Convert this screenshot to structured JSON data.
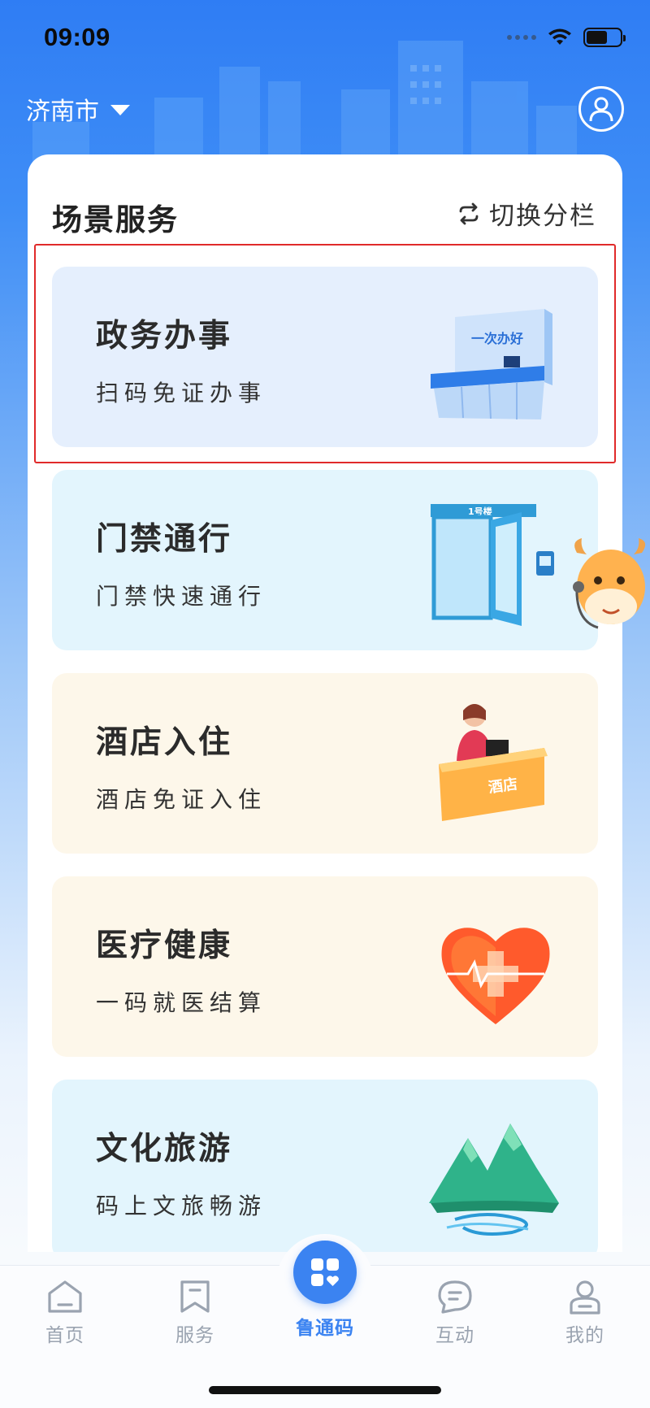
{
  "status_bar": {
    "time": "09:09"
  },
  "header": {
    "city": "济南市",
    "profile_icon": "user-circle-icon"
  },
  "section": {
    "title": "场景服务",
    "switch_label": "切换分栏",
    "switch_icon": "swap-arrows-icon"
  },
  "cards": [
    {
      "title": "政务办事",
      "subtitle": "扫码免证办事",
      "art_text": "一次办好",
      "icon": "service-counter-illustration"
    },
    {
      "title": "门禁通行",
      "subtitle": "门禁快速通行",
      "art_text": "1号楼",
      "icon": "door-access-illustration"
    },
    {
      "title": "酒店入住",
      "subtitle": "酒店免证入住",
      "art_text": "酒店",
      "icon": "hotel-reception-illustration"
    },
    {
      "title": "医疗健康",
      "subtitle": "一码就医结算",
      "icon": "medical-heart-illustration"
    },
    {
      "title": "文化旅游",
      "subtitle": "码上文旅畅游",
      "icon": "mountain-river-illustration"
    }
  ],
  "tabs": [
    {
      "label": "首页",
      "icon": "home-icon"
    },
    {
      "label": "服务",
      "icon": "bookmark-icon"
    },
    {
      "label": "鲁通码",
      "icon": "apps-grid-icon",
      "active": true
    },
    {
      "label": "互动",
      "icon": "chat-bubble-icon"
    },
    {
      "label": "我的",
      "icon": "person-icon"
    }
  ],
  "colors": {
    "primary": "#3b83f1",
    "highlight_border": "#e02a2a",
    "card_blue": "#e5effd",
    "card_cyan": "#e3f5fd",
    "card_cream": "#fdf7ea"
  }
}
